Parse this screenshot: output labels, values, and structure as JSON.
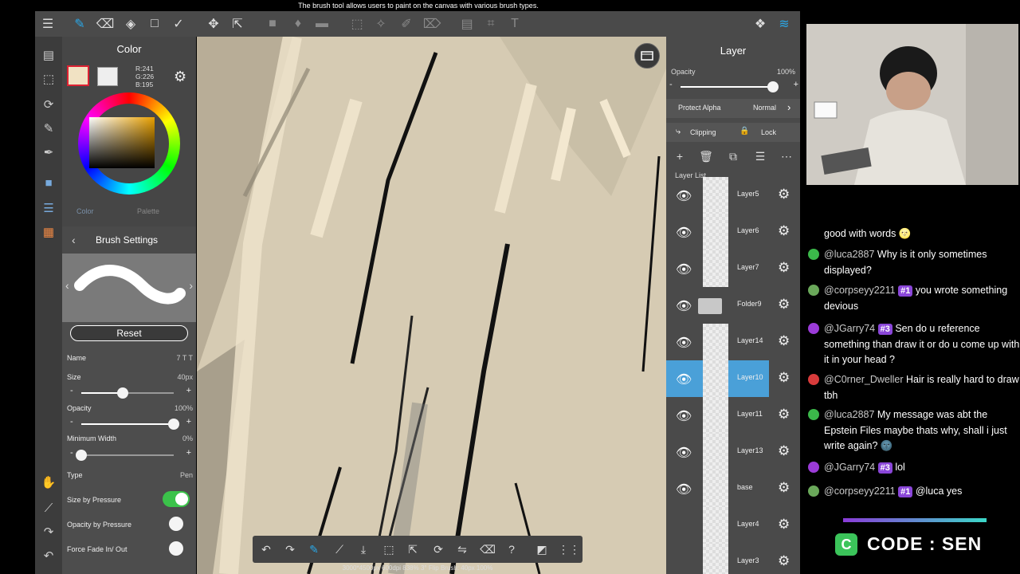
{
  "tooltip": "The brush tool allows users to paint on the canvas with various brush types.",
  "color_panel": {
    "title": "Color",
    "rgb_r": "R:241",
    "rgb_g": "G:226",
    "rgb_b": "B:195",
    "tab_color": "Color",
    "tab_palette": "Palette",
    "foreground_color": "#f1e2c3"
  },
  "brush_settings": {
    "title": "Brush Settings",
    "reset_label": "Reset",
    "name_label": "Name",
    "name_value": "7 T T",
    "size_label": "Size",
    "size_value": "40px",
    "size_fraction": 0.45,
    "opacity_label": "Opacity",
    "opacity_value": "100%",
    "opacity_fraction": 1.0,
    "min_width_label": "Minimum Width",
    "min_width_value": "0%",
    "min_width_fraction": 0.0,
    "type_label": "Type",
    "type_value": "Pen",
    "size_by_pressure_label": "Size by Pressure",
    "size_by_pressure_on": true,
    "opacity_by_pressure_label": "Opacity by Pressure",
    "force_fade_label": "Force Fade In/ Out"
  },
  "layer_panel": {
    "title": "Layer",
    "opacity_label": "Opacity",
    "opacity_value": "100%",
    "opacity_fraction": 1.0,
    "protect_alpha_label": "Protect Alpha",
    "blend_mode": "Normal",
    "clipping_label": "Clipping",
    "lock_label": "Lock",
    "layer_list_label": "Layer List",
    "layers": [
      {
        "name": "Layer5",
        "selected": false
      },
      {
        "name": "Layer6",
        "selected": false
      },
      {
        "name": "Layer7",
        "selected": false
      },
      {
        "name": "Folder9",
        "selected": false
      },
      {
        "name": "Layer14",
        "selected": false
      },
      {
        "name": "Layer10",
        "selected": true
      },
      {
        "name": "Layer11",
        "selected": false
      },
      {
        "name": "Layer13",
        "selected": false
      },
      {
        "name": "base",
        "selected": false
      },
      {
        "name": "Layer4",
        "selected": false
      },
      {
        "name": "Layer3",
        "selected": false
      }
    ]
  },
  "status_bar": "3000*4500px 600dpi 838% 3° Flip Brush: 40px 100%",
  "chat": {
    "messages": [
      {
        "user": "",
        "text": "good with words 🌝",
        "badge": ""
      },
      {
        "user": "@luca2887",
        "text": "Why is it only sometimes displayed?",
        "badge": ""
      },
      {
        "user": "@corpseyy2211",
        "text": "you wrote something devious",
        "badge": "#1"
      },
      {
        "user": "@JGarry74",
        "text": "Sen do u reference something than draw it or do u come up with it in your head ?",
        "badge": "#3"
      },
      {
        "user": "@C0rner_Dweller",
        "text": "Hair is really hard to draw tbh",
        "badge": ""
      },
      {
        "user": "@luca2887",
        "text": "My message was abt the Epstein Files maybe thats why, shall i just write again? 🌚",
        "badge": ""
      },
      {
        "user": "@JGarry74",
        "text": "lol",
        "badge": "#3"
      },
      {
        "user": "@corpseyy2211",
        "text": "@luca yes",
        "badge": "#1"
      }
    ]
  },
  "code": {
    "letter": "C",
    "text": "CODE : SEN"
  }
}
